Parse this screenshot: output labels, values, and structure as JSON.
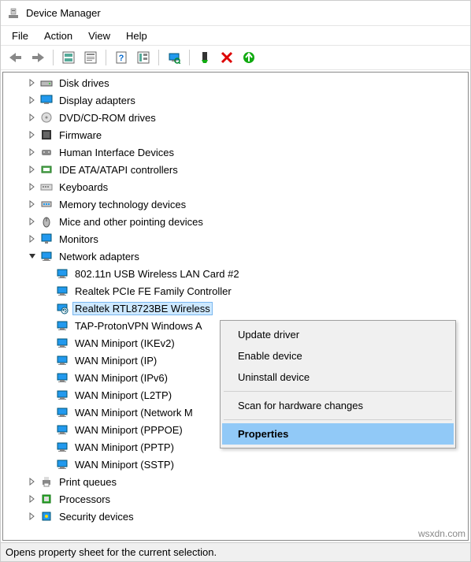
{
  "window": {
    "title": "Device Manager"
  },
  "menubar": [
    "File",
    "Action",
    "View",
    "Help"
  ],
  "tree": [
    {
      "label": "Disk drives",
      "icon": "disk",
      "level": 1,
      "exp": ">"
    },
    {
      "label": "Display adapters",
      "icon": "display",
      "level": 1,
      "exp": ">"
    },
    {
      "label": "DVD/CD-ROM drives",
      "icon": "dvd",
      "level": 1,
      "exp": ">"
    },
    {
      "label": "Firmware",
      "icon": "firmware",
      "level": 1,
      "exp": ">"
    },
    {
      "label": "Human Interface Devices",
      "icon": "hid",
      "level": 1,
      "exp": ">"
    },
    {
      "label": "IDE ATA/ATAPI controllers",
      "icon": "ide",
      "level": 1,
      "exp": ">"
    },
    {
      "label": "Keyboards",
      "icon": "keyboard",
      "level": 1,
      "exp": ">"
    },
    {
      "label": "Memory technology devices",
      "icon": "memtech",
      "level": 1,
      "exp": ">"
    },
    {
      "label": "Mice and other pointing devices",
      "icon": "mouse",
      "level": 1,
      "exp": ">"
    },
    {
      "label": "Monitors",
      "icon": "monitor",
      "level": 1,
      "exp": ">"
    },
    {
      "label": "Network adapters",
      "icon": "net",
      "level": 1,
      "exp": "v"
    },
    {
      "label": "802.11n USB Wireless LAN Card #2",
      "icon": "net",
      "level": 2,
      "exp": ""
    },
    {
      "label": "Realtek PCIe FE Family Controller",
      "icon": "net",
      "level": 2,
      "exp": ""
    },
    {
      "label": "Realtek RTL8723BE Wireless",
      "icon": "net-refresh",
      "level": 2,
      "exp": "",
      "selected": true
    },
    {
      "label": "TAP-ProtonVPN Windows A",
      "icon": "net",
      "level": 2,
      "exp": ""
    },
    {
      "label": "WAN Miniport (IKEv2)",
      "icon": "net",
      "level": 2,
      "exp": ""
    },
    {
      "label": "WAN Miniport (IP)",
      "icon": "net",
      "level": 2,
      "exp": ""
    },
    {
      "label": "WAN Miniport (IPv6)",
      "icon": "net",
      "level": 2,
      "exp": ""
    },
    {
      "label": "WAN Miniport (L2TP)",
      "icon": "net",
      "level": 2,
      "exp": ""
    },
    {
      "label": "WAN Miniport (Network M",
      "icon": "net",
      "level": 2,
      "exp": ""
    },
    {
      "label": "WAN Miniport (PPPOE)",
      "icon": "net",
      "level": 2,
      "exp": ""
    },
    {
      "label": "WAN Miniport (PPTP)",
      "icon": "net",
      "level": 2,
      "exp": ""
    },
    {
      "label": "WAN Miniport (SSTP)",
      "icon": "net",
      "level": 2,
      "exp": ""
    },
    {
      "label": "Print queues",
      "icon": "printer",
      "level": 1,
      "exp": ">"
    },
    {
      "label": "Processors",
      "icon": "cpu",
      "level": 1,
      "exp": ">"
    },
    {
      "label": "Security devices",
      "icon": "security",
      "level": 1,
      "exp": ">"
    }
  ],
  "context_menu": {
    "items": [
      {
        "label": "Update driver",
        "type": "item"
      },
      {
        "label": "Enable device",
        "type": "item"
      },
      {
        "label": "Uninstall device",
        "type": "item"
      },
      {
        "type": "divider"
      },
      {
        "label": "Scan for hardware changes",
        "type": "item"
      },
      {
        "type": "divider"
      },
      {
        "label": "Properties",
        "type": "item",
        "highlight": true
      }
    ]
  },
  "statusbar": {
    "text": "Opens property sheet for the current selection."
  },
  "watermark": "wsxdn.com"
}
